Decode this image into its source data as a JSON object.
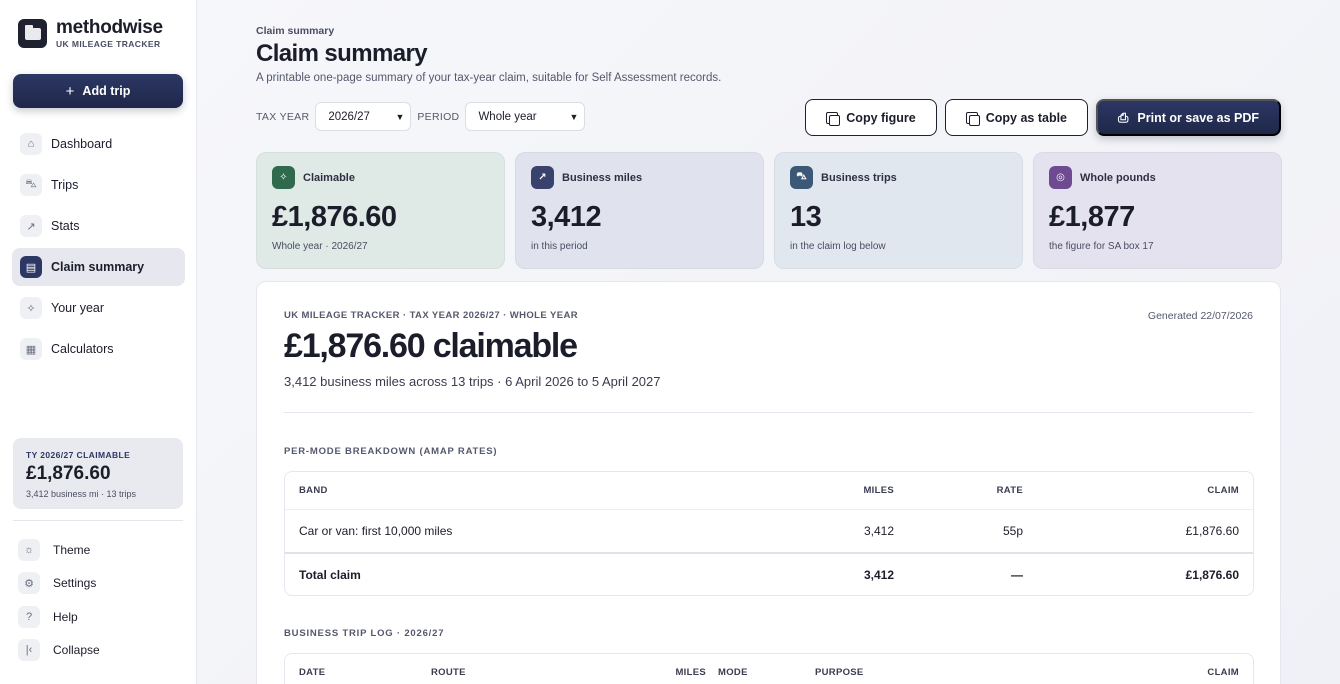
{
  "brand": {
    "name": "methodwise",
    "subtitle": "UK MILEAGE TRACKER"
  },
  "sidebar": {
    "add_trip": "Add trip",
    "items": [
      {
        "label": "Dashboard",
        "icon": "home-icon"
      },
      {
        "label": "Trips",
        "icon": "car-icon"
      },
      {
        "label": "Stats",
        "icon": "trend-icon"
      },
      {
        "label": "Claim summary",
        "icon": "document-icon",
        "active": true
      },
      {
        "label": "Your year",
        "icon": "sparkle-icon"
      },
      {
        "label": "Calculators",
        "icon": "calculator-icon"
      }
    ],
    "ty_card": {
      "label": "TY 2026/27 CLAIMABLE",
      "amount": "£1,876.60",
      "sub": "3,412 business mi · 13 trips"
    },
    "bottom": [
      {
        "label": "Theme",
        "icon": "sun-icon"
      },
      {
        "label": "Settings",
        "icon": "gear-icon"
      },
      {
        "label": "Help",
        "icon": "help-icon"
      },
      {
        "label": "Collapse",
        "icon": "collapse-icon"
      }
    ]
  },
  "header": {
    "breadcrumb": "Claim summary",
    "title": "Claim summary",
    "description": "A printable one-page summary of your tax-year claim, suitable for Self Assessment records."
  },
  "controls": {
    "tax_year_label": "TAX YEAR",
    "tax_year_value": "2026/27",
    "period_label": "PERIOD",
    "period_value": "Whole year"
  },
  "actions": {
    "copy_figure": "Copy figure",
    "copy_table": "Copy as table",
    "print": "Print or save as PDF"
  },
  "stats": [
    {
      "title": "Claimable",
      "value": "£1,876.60",
      "sub": "Whole year · 2026/27",
      "color": "#2f6a4f"
    },
    {
      "title": "Business miles",
      "value": "3,412",
      "sub": "in this period",
      "color": "#39426d"
    },
    {
      "title": "Business trips",
      "value": "13",
      "sub": "in the claim log below",
      "color": "#3c5877"
    },
    {
      "title": "Whole pounds",
      "value": "£1,877",
      "sub": "the figure for SA box 17",
      "color": "#6d4a92"
    }
  ],
  "summary": {
    "kicker": "UK MILEAGE TRACKER · TAX YEAR 2026/27 · WHOLE YEAR",
    "generated": "Generated 22/07/2026",
    "headline": "£1,876.60 claimable",
    "subline": "3,412 business miles across 13 trips · 6 April 2026 to 5 April 2027",
    "breakdown": {
      "heading": "PER-MODE BREAKDOWN (AMAP RATES)",
      "columns": {
        "band": "BAND",
        "miles": "MILES",
        "rate": "RATE",
        "claim": "CLAIM"
      },
      "rows": [
        {
          "band": "Car or van: first 10,000 miles",
          "miles": "3,412",
          "rate": "55p",
          "claim": "£1,876.60"
        }
      ],
      "total": {
        "band": "Total claim",
        "miles": "3,412",
        "rate": "—",
        "claim": "£1,876.60"
      }
    },
    "log": {
      "heading": "BUSINESS TRIP LOG · 2026/27",
      "columns": {
        "date": "DATE",
        "route": "ROUTE",
        "miles": "MILES",
        "mode": "MODE",
        "purpose": "PURPOSE",
        "claim": "CLAIM"
      }
    }
  }
}
